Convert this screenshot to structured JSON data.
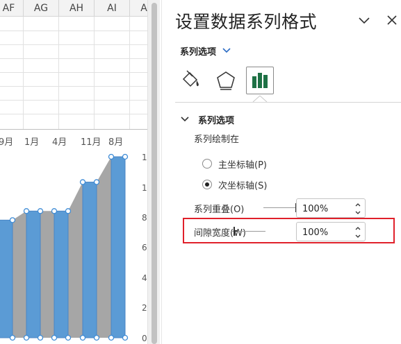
{
  "sheet": {
    "column_headers": [
      "AF",
      "AG",
      "AH",
      "AI",
      "A"
    ],
    "chart": {
      "x_tick_labels": [
        "9月",
        "1月",
        "4月",
        "11月",
        "8月"
      ],
      "right_axis_labels": [
        "1",
        "1",
        "8",
        "6",
        "4",
        "2",
        "0"
      ]
    }
  },
  "chart_data": {
    "type": "bar",
    "categories": [
      "9月",
      "1月",
      "4月",
      "11月",
      "8月"
    ],
    "series": [
      {
        "values": [
          0.65,
          0.7,
          0.7,
          0.86,
          1.0
        ]
      }
    ],
    "color": "#5b9bd5",
    "gap_color": "#a6a6a6"
  },
  "pane": {
    "title": "设置数据系列格式",
    "series_dropdown": "系列选项",
    "tabs": {
      "fill": "paint-bucket-icon",
      "effects": "pentagon-icon",
      "options": "bar-chart-icon"
    },
    "section": {
      "label": "系列选项",
      "plot_on_label": "系列绘制在",
      "radio_primary": "主坐标轴(P)",
      "radio_secondary": "次坐标轴(S)",
      "selected": "secondary",
      "overlap": {
        "label": "系列重叠(O)",
        "value": "100%"
      },
      "gap": {
        "label": "间隙宽度(W)",
        "value": "100%"
      }
    },
    "highlight_color": "#e0202a"
  }
}
